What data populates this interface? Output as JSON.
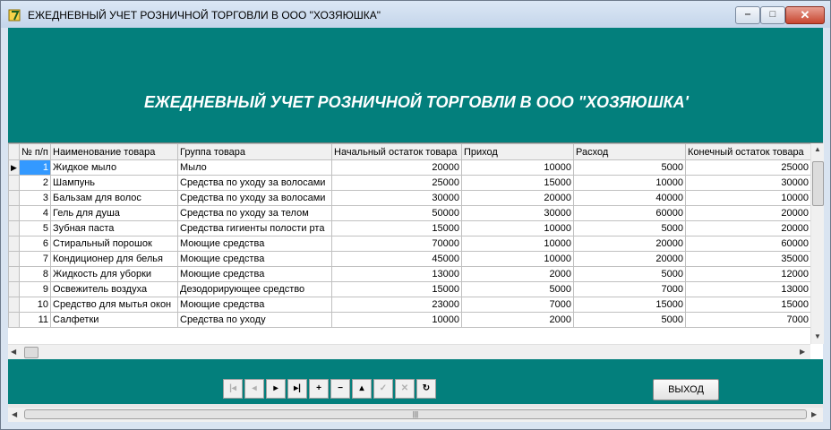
{
  "window": {
    "title": "ЕЖЕДНЕВНЫЙ УЧЕТ РОЗНИЧНОЙ ТОРГОВЛИ В ООО \"ХОЗЯЮШКА\""
  },
  "header": {
    "title": "ЕЖЕДНЕВНЫЙ УЧЕТ РОЗНИЧНОЙ ТОРГОВЛИ В ООО \"ХОЗЯЮШКА'"
  },
  "grid": {
    "columns": [
      "№ п/п",
      "Наименование товара",
      "Группа товара",
      "Начальный остаток товара",
      "Приход",
      "Расход",
      "Конечный остаток товара"
    ],
    "rows": [
      {
        "n": "1",
        "name": "Жидкое мыло",
        "group": "Мыло",
        "start": "20000",
        "in": "10000",
        "out": "5000",
        "end": "25000"
      },
      {
        "n": "2",
        "name": "Шампунь",
        "group": "Средства по уходу за волосами",
        "start": "25000",
        "in": "15000",
        "out": "10000",
        "end": "30000"
      },
      {
        "n": "3",
        "name": "Бальзам для волос",
        "group": "Средства по уходу за волосами",
        "start": "30000",
        "in": "20000",
        "out": "40000",
        "end": "10000"
      },
      {
        "n": "4",
        "name": "Гель для душа",
        "group": "Средства по уходу за телом",
        "start": "50000",
        "in": "30000",
        "out": "60000",
        "end": "20000"
      },
      {
        "n": "5",
        "name": "Зубная паста",
        "group": "Средства гигиенты полости рта",
        "start": "15000",
        "in": "10000",
        "out": "5000",
        "end": "20000"
      },
      {
        "n": "6",
        "name": "Стиральный порошок",
        "group": "Моющие средства",
        "start": "70000",
        "in": "10000",
        "out": "20000",
        "end": "60000"
      },
      {
        "n": "7",
        "name": "Кондиционер для белья",
        "group": "Моющие средства",
        "start": "45000",
        "in": "10000",
        "out": "20000",
        "end": "35000"
      },
      {
        "n": "8",
        "name": "Жидкость для уборки",
        "group": "Моющие средства",
        "start": "13000",
        "in": "2000",
        "out": "5000",
        "end": "12000"
      },
      {
        "n": "9",
        "name": "Освежитель воздуха",
        "group": "Дезодорирующее средство",
        "start": "15000",
        "in": "5000",
        "out": "7000",
        "end": "13000"
      },
      {
        "n": "10",
        "name": "Средство для мытья окон",
        "group": "Моющие средства",
        "start": "23000",
        "in": "7000",
        "out": "15000",
        "end": "15000"
      },
      {
        "n": "11",
        "name": "Салфетки",
        "group": "Средства по уходу",
        "start": "10000",
        "in": "2000",
        "out": "5000",
        "end": "7000"
      }
    ]
  },
  "navigator": {
    "buttons": [
      {
        "name": "nav-first-button",
        "glyph": "|◂",
        "disabled": true
      },
      {
        "name": "nav-prior-button",
        "glyph": "◂",
        "disabled": true
      },
      {
        "name": "nav-next-button",
        "glyph": "▸",
        "disabled": false
      },
      {
        "name": "nav-last-button",
        "glyph": "▸|",
        "disabled": false
      },
      {
        "name": "nav-insert-button",
        "glyph": "+",
        "disabled": false
      },
      {
        "name": "nav-delete-button",
        "glyph": "−",
        "disabled": false
      },
      {
        "name": "nav-edit-button",
        "glyph": "▴",
        "disabled": false
      },
      {
        "name": "nav-post-button",
        "glyph": "✓",
        "disabled": true
      },
      {
        "name": "nav-cancel-button",
        "glyph": "✕",
        "disabled": true
      },
      {
        "name": "nav-refresh-button",
        "glyph": "↻",
        "disabled": false
      }
    ]
  },
  "exit_label": "ВЫХОД"
}
